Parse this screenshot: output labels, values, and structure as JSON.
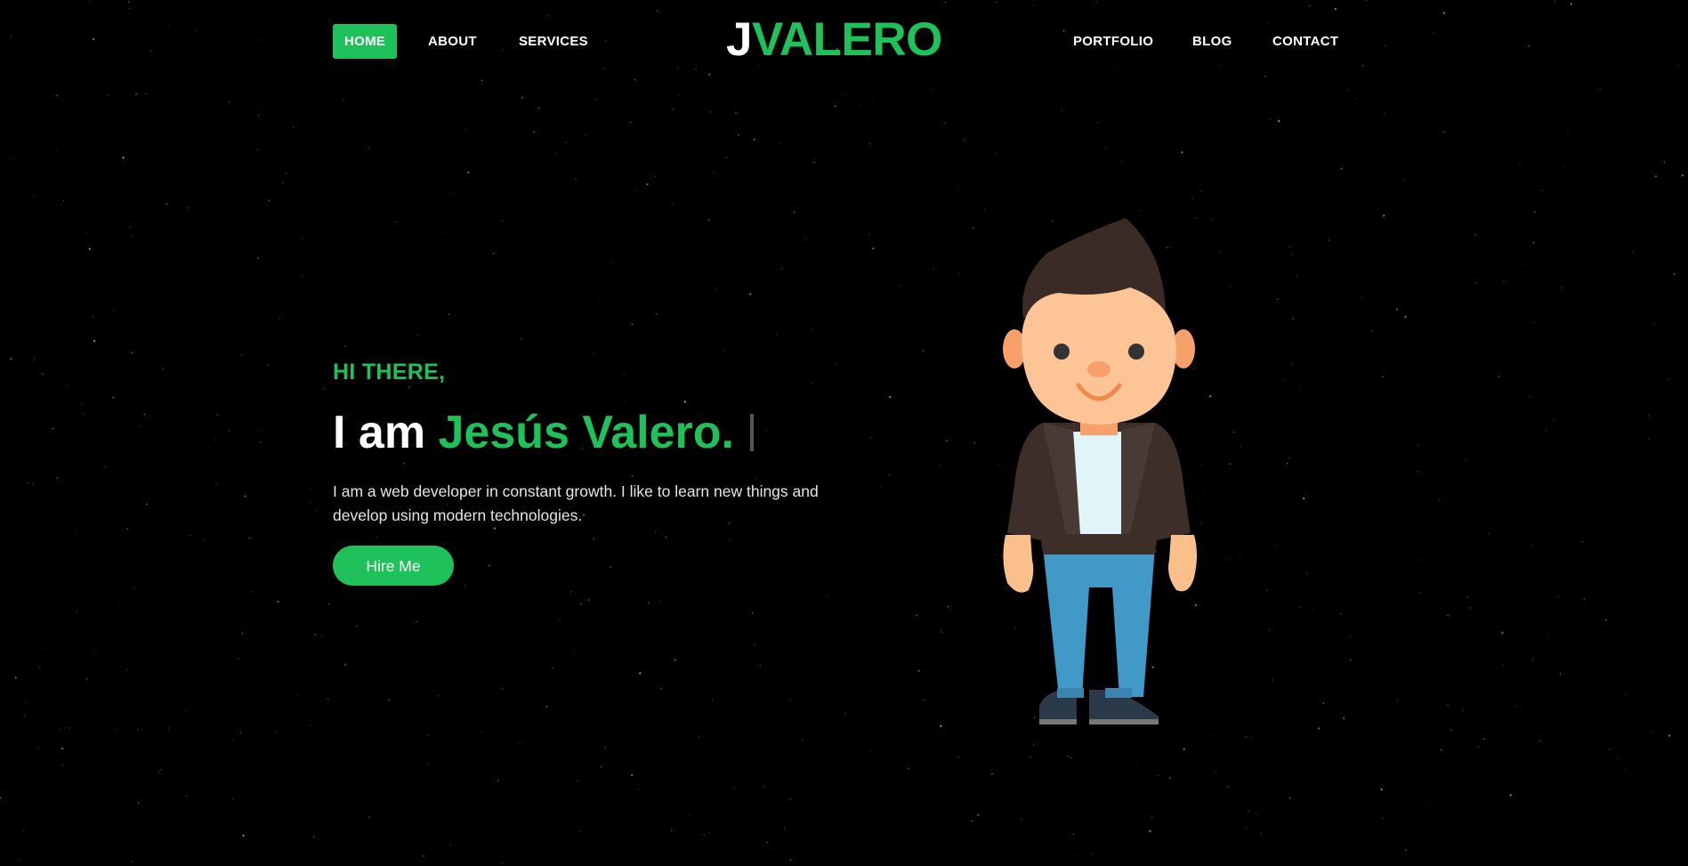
{
  "nav": {
    "left": [
      {
        "label": "HOME",
        "active": true
      },
      {
        "label": "ABOUT",
        "active": false
      },
      {
        "label": "SERVICES",
        "active": false
      }
    ],
    "right": [
      {
        "label": "PORTFOLIO",
        "active": false
      },
      {
        "label": "BLOG",
        "active": false
      },
      {
        "label": "CONTACT",
        "active": false
      }
    ]
  },
  "logo": {
    "first": "J",
    "rest": "VALERO"
  },
  "hero": {
    "greeting": "HI THERE,",
    "headline_prefix": "I am ",
    "headline_name": "Jesús Valero.",
    "description": "I am a web developer in constant growth. I like to learn new things and develop using modern technologies.",
    "cta_label": "Hire Me"
  },
  "colors": {
    "accent": "#1fc25a",
    "background": "#000000"
  },
  "icons": {
    "avatar": "cartoon-developer-illustration"
  }
}
